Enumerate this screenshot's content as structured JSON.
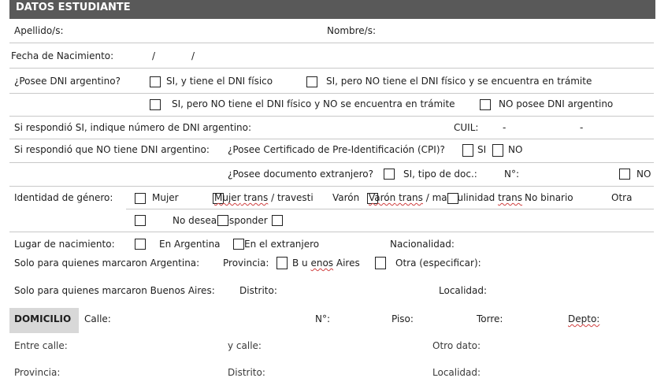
{
  "header": {
    "title": "DATOS ESTUDIANTE"
  },
  "row1": {
    "apellido": "Apellido/s:",
    "nombre": "Nombre/s:"
  },
  "row2": {
    "fecha": "Fecha de Nacimiento:",
    "slash1": "/",
    "slash2": "/"
  },
  "dni": {
    "question": "¿Posee DNI argentino?",
    "opt1": "SI, y tiene el DNI físico",
    "opt2": "SI, pero NO tiene el DNI físico y se encuentra en trámite",
    "opt3": "SI, pero NO tiene el DNI físico  y NO se encuentra en trámite",
    "opt4": "NO posee DNI argentino"
  },
  "dni_number": {
    "label": "Si respondió SI, indique número de DNI argentino:",
    "cuil": "CUIL:",
    "dash1": "-",
    "dash2": "-"
  },
  "cpi": {
    "label": "Si respondió que NO tiene DNI argentino:",
    "question": "¿Posee Certificado de Pre-Identificación (CPI)?",
    "si": "SI",
    "no": "NO"
  },
  "extranjero": {
    "question": "¿Posee documento extranjero?",
    "si_tipo": "SI, tipo de doc.:",
    "numero": "N°:",
    "no": "NO"
  },
  "genero": {
    "label": "Identidad de género:",
    "mujer": "Mujer",
    "mujer_trans_a": "Mujer",
    "mujer_trans_b": " trans",
    "mujer_trans_c": " / travesti",
    "varon": "Varón",
    "varon_trans_a": "Varón",
    "varon_trans_b": " trans",
    "varon_trans_c": " / masculinidad ",
    "varon_trans_d": "trans",
    "no_binario": "No binario",
    "otra": "Otra",
    "no_responder": "No desea responder"
  },
  "nacimiento": {
    "label": "Lugar de nacimiento:",
    "argentina": "En Argentina",
    "extranjero": "En el extranjero",
    "nacionalidad": "Nacionalidad:"
  },
  "provincia": {
    "label": "Solo para quienes marcaron Argentina:",
    "provincia": "Provincia:",
    "ba_a": "B u ",
    "ba_b": "enos",
    "ba_c": " Aires",
    "otra": "Otra (especificar):"
  },
  "buenos_aires": {
    "label": "Solo para quienes marcaron Buenos Aires:",
    "distrito": "Distrito:",
    "localidad": "Localidad:"
  },
  "domicilio": {
    "label": "DOMICILIO",
    "calle": "Calle:",
    "numero": "N°:",
    "piso": "Piso:",
    "torre": "Torre:",
    "depto": "Depto:"
  },
  "entre": {
    "entre_calle": "Entre calle:",
    "y_calle": "y calle:",
    "otro": "Otro dato:"
  },
  "last": {
    "provincia": "Provincia:",
    "distrito": "Distrito:",
    "localidad": "Localidad:"
  }
}
